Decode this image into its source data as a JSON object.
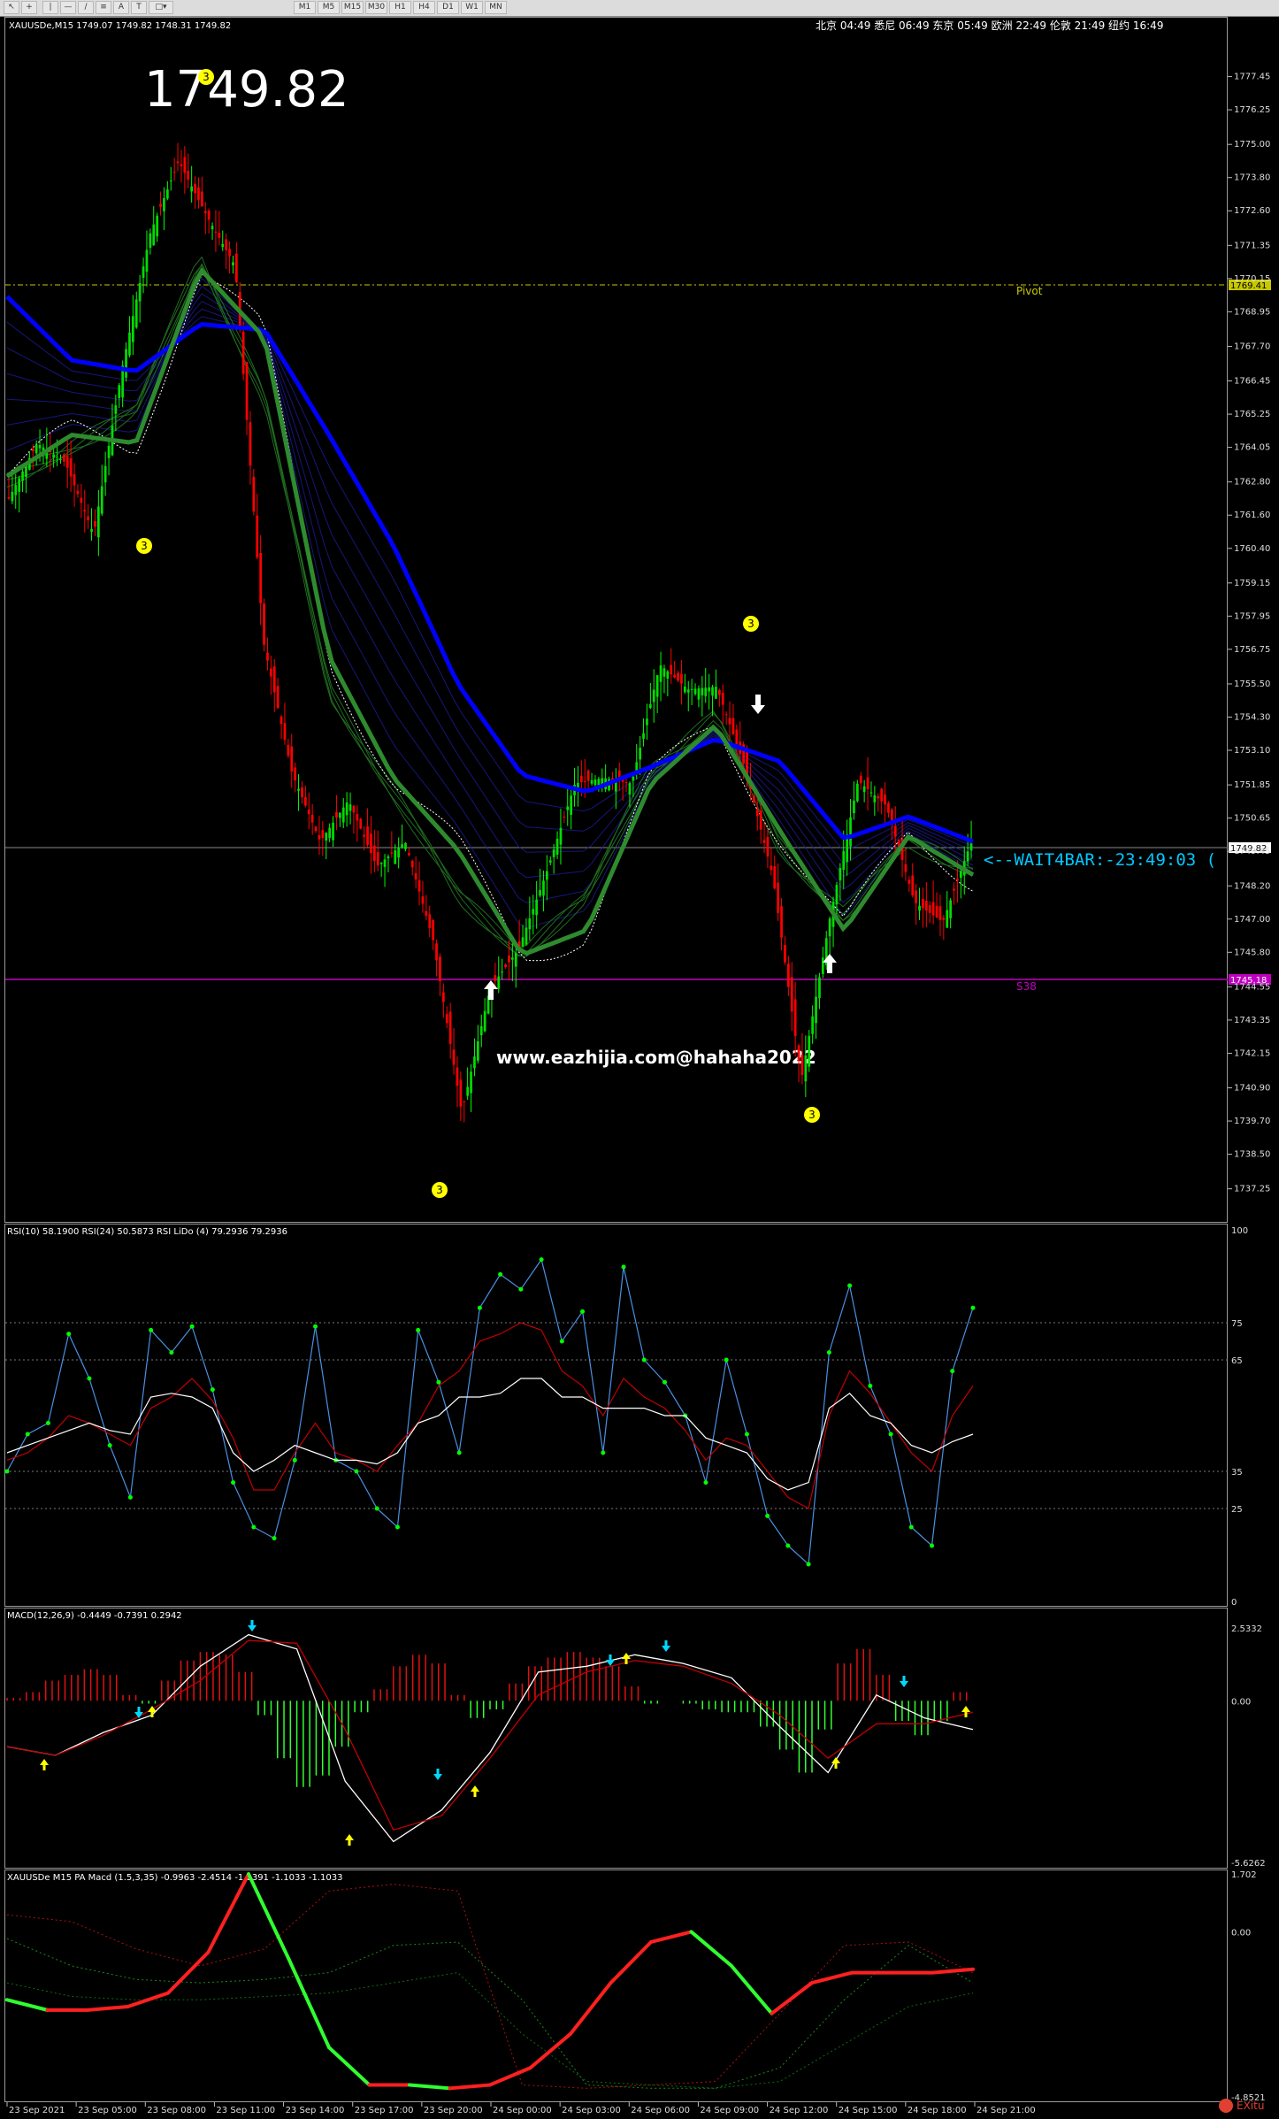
{
  "toolbar": {
    "tools": [
      "cursor",
      "crosshair",
      "vertical-line",
      "horizontal-line",
      "trendline",
      "fibonacci",
      "text",
      "label",
      "shapes"
    ],
    "timeframes": [
      "M1",
      "M5",
      "M15",
      "M30",
      "H1",
      "H4",
      "D1",
      "W1",
      "MN"
    ]
  },
  "header": {
    "symbol_line": "XAUUSDe,M15  1749.07 1749.82 1748.31 1749.82",
    "clocks": "北京 04:49  悉尼 06:49  东京 05:49  欧洲 22:49  伦敦 21:49  纽约 16:49"
  },
  "big_price": "1749.82",
  "watermark": "www.eazhijia.com@hahaha2022",
  "timer_text": "<--WAIT4BAR:-23:49:03 (",
  "levels": {
    "pivot_label": "Pivot",
    "pivot_value": "1769.41",
    "s38_label": "S38",
    "s38_value": "1745.18",
    "current_value": "1749.82"
  },
  "price_axis": [
    "1777.45",
    "1776.25",
    "1775.00",
    "1773.80",
    "1772.60",
    "1771.35",
    "1770.15",
    "1768.95",
    "1767.70",
    "1766.45",
    "1765.25",
    "1764.05",
    "1762.80",
    "1761.60",
    "1760.40",
    "1759.15",
    "1757.95",
    "1756.75",
    "1755.50",
    "1754.30",
    "1753.10",
    "1751.85",
    "1750.65",
    "1749.45",
    "1748.20",
    "1747.00",
    "1745.80",
    "1744.55",
    "1743.35",
    "1742.15",
    "1740.90",
    "1739.70",
    "1738.50",
    "1737.25"
  ],
  "time_axis": [
    "23 Sep 2021",
    "23 Sep 05:00",
    "23 Sep 08:00",
    "23 Sep 11:00",
    "23 Sep 14:00",
    "23 Sep 17:00",
    "23 Sep 20:00",
    "24 Sep 00:00",
    "24 Sep 03:00",
    "24 Sep 06:00",
    "24 Sep 09:00",
    "24 Sep 12:00",
    "24 Sep 15:00",
    "24 Sep 18:00",
    "24 Sep 21:00"
  ],
  "markers": {
    "three": "3"
  },
  "rsi": {
    "label": "RSI(10) 58.1900  RSI(24) 50.5873  RSI LiDo (4) 79.2936 79.2936",
    "axis": [
      "100",
      "75",
      "65",
      "35",
      "25",
      "0"
    ]
  },
  "macd": {
    "label": "MACD(12,26,9) -0.4449 -0.7391 0.2942",
    "axis": [
      "2.5332",
      "0.00",
      "-5.6262"
    ]
  },
  "pamacd": {
    "label": "XAUUSDe M15 PA Macd (1.5,3,35) -0.9963 -2.4514 -1.2391 -1.1033 -1.1033",
    "axis": [
      "1.702",
      "0.00",
      "-4.8521"
    ]
  },
  "brand": "EXitu",
  "colors": {
    "background": "#000000",
    "bull": "#00ff00",
    "bear": "#ff0000",
    "ema_slow": "#0000ff",
    "ema_fast": "#2e8b2e",
    "pivot": "#c8c800",
    "s38": "#c000c0",
    "timer": "#00c8ff",
    "marker": "#ffff00",
    "rsi_fast": "#4a90e2",
    "rsi_slow": "#c00000",
    "rsi_lido": "#ffffff"
  },
  "chart_data": [
    {
      "type": "candlestick",
      "title": "XAUUSDe,M15",
      "ylim": [
        1736.6,
        1778.3
      ],
      "x": [
        "23 Sep 2021",
        "23 Sep 05:00",
        "23 Sep 08:00",
        "23 Sep 11:00",
        "23 Sep 14:00",
        "23 Sep 17:00",
        "23 Sep 20:00",
        "24 Sep 00:00",
        "24 Sep 03:00",
        "24 Sep 06:00",
        "24 Sep 09:00",
        "24 Sep 12:00",
        "24 Sep 15:00",
        "24 Sep 18:00",
        "24 Sep 21:00"
      ],
      "close_path": [
        1762.2,
        1764.2,
        1763.5,
        1760.9,
        1766.9,
        1771.8,
        1774.4,
        1772.4,
        1770.6,
        1757.0,
        1752.3,
        1749.8,
        1751.3,
        1748.9,
        1749.8,
        1746.2,
        1740.0,
        1744.5,
        1745.9,
        1748.7,
        1751.9,
        1752.1,
        1751.9,
        1756.2,
        1755.3,
        1755.4,
        1752.5,
        1748.5,
        1741.2,
        1747.0,
        1752.0,
        1751.1,
        1747.6,
        1746.9,
        1749.8
      ],
      "series": [
        {
          "name": "EMA slow",
          "values": [
            1769.5,
            1767.2,
            1766.8,
            1768.5,
            1768.3,
            1764.5,
            1760.5,
            1755.5,
            1752.2,
            1751.6,
            1752.5,
            1753.5,
            1752.7,
            1749.9,
            1750.7,
            1749.8
          ]
        },
        {
          "name": "EMA fast",
          "values": [
            1763.0,
            1764.5,
            1764.2,
            1770.5,
            1768.0,
            1756.5,
            1752.1,
            1749.5,
            1745.7,
            1746.6,
            1751.9,
            1754.0,
            1750.2,
            1746.6,
            1750.0,
            1748.6
          ]
        }
      ],
      "levels": [
        {
          "name": "Pivot",
          "value": 1769.41
        },
        {
          "name": "S38",
          "value": 1745.18
        }
      ]
    },
    {
      "type": "line",
      "title": "RSI(10) 58.1900  RSI(24) 50.5873  RSI LiDo (4) 79.2936 79.2936",
      "ylim": [
        0,
        100
      ],
      "levels": [
        75,
        65,
        35,
        25
      ],
      "series": [
        {
          "name": "RSI(10)",
          "values": [
            35,
            45,
            48,
            72,
            60,
            42,
            28,
            73,
            67,
            74,
            57,
            32,
            20,
            17,
            38,
            74,
            38,
            35,
            25,
            20,
            73,
            59,
            40,
            79,
            88,
            84,
            92,
            70,
            78,
            40,
            90,
            65,
            59,
            50,
            32,
            65,
            45,
            23,
            15,
            10,
            67,
            85,
            58,
            45,
            20,
            15,
            62,
            79
          ]
        },
        {
          "name": "RSI(24)",
          "values": [
            38,
            40,
            44,
            50,
            48,
            45,
            42,
            52,
            55,
            60,
            54,
            44,
            30,
            30,
            40,
            48,
            40,
            38,
            35,
            42,
            48,
            58,
            62,
            70,
            72,
            75,
            73,
            62,
            58,
            50,
            60,
            55,
            52,
            46,
            38,
            44,
            42,
            35,
            28,
            25,
            50,
            62,
            56,
            48,
            40,
            35,
            50,
            58
          ]
        },
        {
          "name": "RSI LiDo (4)",
          "values": [
            40,
            42,
            44,
            46,
            48,
            46,
            45,
            55,
            56,
            55,
            52,
            40,
            35,
            38,
            42,
            40,
            38,
            38,
            37,
            40,
            48,
            50,
            55,
            55,
            56,
            60,
            60,
            55,
            55,
            52,
            52,
            52,
            50,
            50,
            44,
            42,
            40,
            33,
            30,
            32,
            52,
            56,
            50,
            48,
            42,
            40,
            43,
            45
          ]
        }
      ]
    },
    {
      "type": "bar",
      "title": "MACD(12,26,9) -0.4449 -0.7391 0.2942",
      "ylim": [
        -5.6262,
        2.5332
      ],
      "histogram": [
        0.1,
        0.3,
        0.7,
        0.9,
        1.1,
        0.9,
        0.2,
        -0.1,
        0.7,
        1.4,
        1.7,
        1.6,
        1.0,
        -0.5,
        -2.0,
        -3.0,
        -2.6,
        -1.6,
        -0.4,
        0.4,
        1.2,
        1.6,
        1.3,
        0.2,
        -0.6,
        -0.3,
        0.6,
        1.2,
        1.5,
        1.7,
        1.5,
        1.2,
        0.5,
        -0.1,
        0.0,
        -0.1,
        -0.3,
        -0.4,
        -0.4,
        -0.9,
        -1.7,
        -2.5,
        -1.0,
        1.3,
        1.8,
        0.9,
        -0.7,
        -1.2,
        -0.7,
        0.3
      ],
      "series": [
        {
          "name": "MACD",
          "values": [
            -1.6,
            -1.9,
            -1.1,
            -0.5,
            1.2,
            2.3,
            1.8,
            -2.8,
            -4.9,
            -3.8,
            -1.8,
            1.0,
            1.2,
            1.6,
            1.3,
            0.8,
            -0.9,
            -2.5,
            0.2,
            -0.6,
            -1.0
          ]
        },
        {
          "name": "Signal",
          "values": [
            -1.6,
            -1.9,
            -1.2,
            -0.3,
            0.7,
            2.1,
            2.0,
            -1.0,
            -4.5,
            -4.0,
            -2.0,
            0.2,
            1.0,
            1.4,
            1.2,
            0.6,
            -0.5,
            -2.0,
            -0.8,
            -0.8,
            -0.4
          ]
        }
      ]
    },
    {
      "type": "line",
      "title": "XAUUSDe M15 PA Macd (1.5,3,35) -0.9963 -2.4514 -1.2391 -1.1033 -1.1033",
      "ylim": [
        -4.8521,
        1.702
      ],
      "series": [
        {
          "name": "PA Macd",
          "values": [
            -2.0,
            -2.3,
            -2.3,
            -2.2,
            -1.8,
            -0.6,
            1.7,
            -0.8,
            -3.4,
            -4.5,
            -4.5,
            -4.6,
            -4.5,
            -4.0,
            -3.0,
            -1.5,
            -0.3,
            0.0,
            -1.0,
            -2.4,
            -1.5,
            -1.2,
            -1.2,
            -1.2,
            -1.1
          ]
        }
      ]
    }
  ]
}
